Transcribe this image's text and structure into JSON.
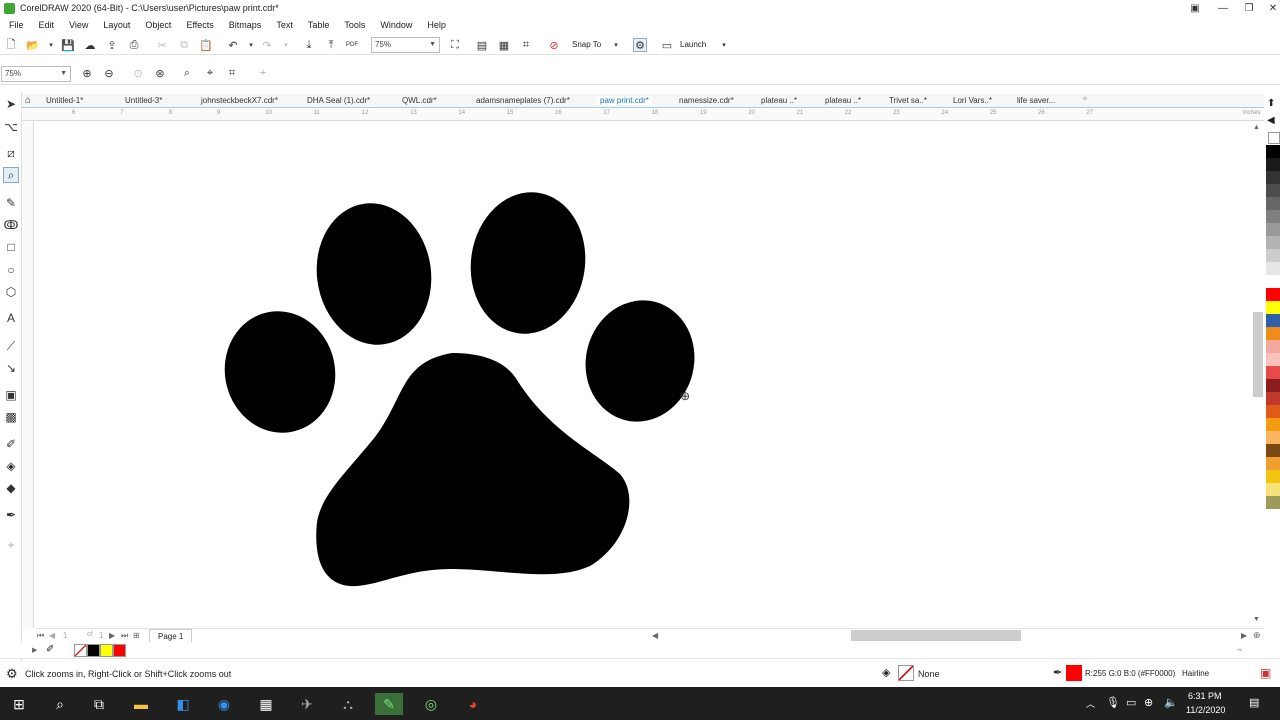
{
  "window": {
    "title": "CorelDRAW 2020 (64-Bit) - C:\\Users\\user\\Pictures\\paw print.cdr*",
    "controls": [
      "restore-down",
      "minimize",
      "maximize",
      "close"
    ]
  },
  "menu": [
    "File",
    "Edit",
    "View",
    "Layout",
    "Object",
    "Effects",
    "Bitmaps",
    "Text",
    "Table",
    "Tools",
    "Window",
    "Help"
  ],
  "toolbar": {
    "zoom_value": "75%",
    "snap_to_label": "Snap To",
    "launch_label": "Launch",
    "pdf_label": "PDF"
  },
  "property_bar": {
    "zoom_value": "75%"
  },
  "tabs": [
    {
      "label": "Untitled-1*",
      "active": false
    },
    {
      "label": "Untitled-3*",
      "active": false
    },
    {
      "label": "johnsteckbeckX7.cdr*",
      "active": false
    },
    {
      "label": "DHA Seal (1).cdr*",
      "active": false
    },
    {
      "label": "QWL.cdr*",
      "active": false
    },
    {
      "label": "adamsnameplates (7).cdr*",
      "active": false
    },
    {
      "label": "paw print.cdr*",
      "active": true
    },
    {
      "label": "namessize.cdr*",
      "active": false
    },
    {
      "label": "plateau ..*",
      "active": false
    },
    {
      "label": "plateau ..*",
      "active": false
    },
    {
      "label": "Trivet sa..*",
      "active": false
    },
    {
      "label": "Lori Vars..*",
      "active": false
    },
    {
      "label": "life saver...",
      "active": false
    }
  ],
  "ruler": {
    "numbers": [
      "6",
      "7",
      "8",
      "9",
      "10",
      "11",
      "12",
      "13",
      "14",
      "15",
      "16",
      "17",
      "18",
      "19",
      "20",
      "21",
      "22",
      "23",
      "24",
      "25",
      "26",
      "27"
    ],
    "unit": "inches"
  },
  "palette_colors": [
    "#000000",
    "#1a1a1a",
    "#333333",
    "#4d4d4d",
    "#666666",
    "#808080",
    "#999999",
    "#b3b3b3",
    "#cccccc",
    "#e6e6e6",
    "#ffffff",
    "#ff0000",
    "#ffff00",
    "#2e5fa8",
    "#f08c1c",
    "#f5a99e",
    "#f7c4b7",
    "#e84a4a",
    "#8a1d1d",
    "#c0392b",
    "#e05a1a",
    "#f39c12",
    "#fbb560",
    "#7a4a12",
    "#f0a030",
    "#f1c40f",
    "#f7e27a",
    "#9e9a5a"
  ],
  "page": {
    "label": "Page 1",
    "of_text": "of"
  },
  "doc_palette": [
    "#ffffff",
    "#000000",
    "#ffff00",
    "#ff0000"
  ],
  "status": {
    "hint": "Click zooms in, Right-Click or Shift+Click zooms out",
    "fill_label": "None",
    "outline_color_text": "R:255 G:0 B:0 (#FF0000)",
    "outline_width": "Hairline",
    "outline_swatch": "#ff0000"
  },
  "taskbar": {
    "time": "6:31 PM",
    "date": "11/2/2020"
  }
}
